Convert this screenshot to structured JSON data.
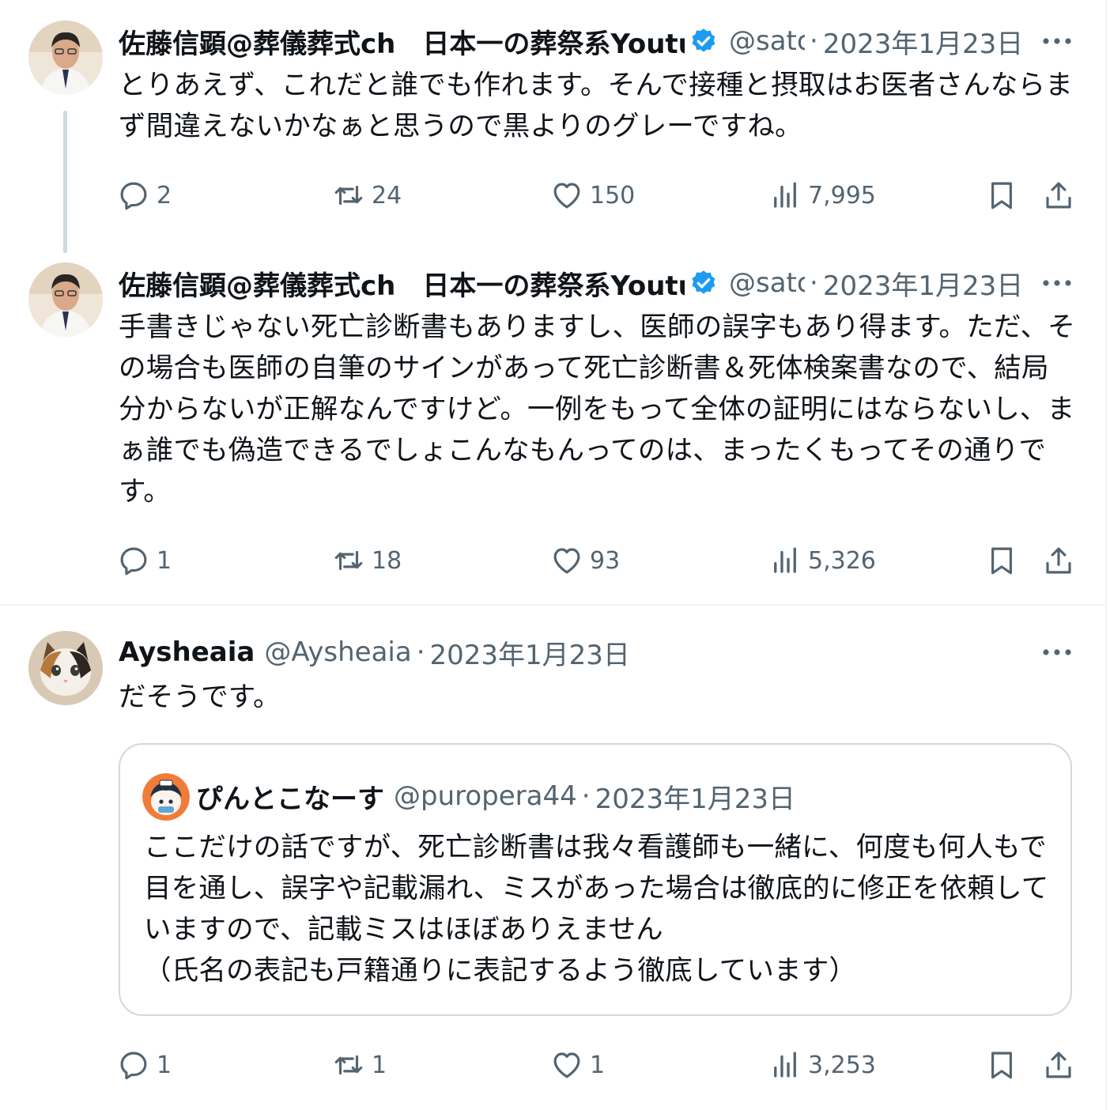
{
  "tweets": [
    {
      "author_name": "佐藤信顕@葬儀葬式ch　日本一の葬祭系Youtuber",
      "handle": "@satc",
      "date": "2023年1月23日",
      "text": "とりあえず、これだと誰でも作れます。そんで接種と摂取はお医者さんならまず間違えないかなぁと思うので黒よりのグレーですね。",
      "replies": "2",
      "retweets": "24",
      "likes": "150",
      "views": "7,995"
    },
    {
      "author_name": "佐藤信顕@葬儀葬式ch　日本一の葬祭系Youtuber",
      "handle": "@satc",
      "date": "2023年1月23日",
      "text": "手書きじゃない死亡診断書もありますし、医師の誤字もあり得ます。ただ、その場合も医師の自筆のサインがあって死亡診断書＆死体検案書なので、結局分からないが正解なんですけど。一例をもって全体の証明にはならないし、まぁ誰でも偽造できるでしょこんなもんってのは、まったくもってその通りです。",
      "replies": "1",
      "retweets": "18",
      "likes": "93",
      "views": "5,326"
    },
    {
      "author_name": "Aysheaia",
      "handle": "@Aysheaia",
      "date": "2023年1月23日",
      "text": "だそうです。",
      "replies": "1",
      "retweets": "1",
      "likes": "1",
      "views": "3,253"
    }
  ],
  "quote": {
    "author_name": "ぴんとこなーす",
    "handle": "@puropera44",
    "date": "2023年1月23日",
    "text": "ここだけの話ですが、死亡診断書は我々看護師も一緒に、何度も何人もで目を通し、誤字や記載漏れ、ミスがあった場合は徹底的に修正を依頼していますので、記載ミスはほぼありえません\n（氏名の表記も戸籍通りに表記するよう徹底しています）"
  },
  "separator": "·",
  "icons": {
    "verified": "verified-badge-icon",
    "more": "more-options-icon",
    "reply": "reply-icon",
    "retweet": "retweet-icon",
    "like": "heart-icon",
    "views": "views-icon",
    "bookmark": "bookmark-icon",
    "share": "share-icon"
  },
  "colors": {
    "text": "#0f1419",
    "secondary": "#536471",
    "verified": "#1d9bf0",
    "border": "#cfd9de"
  }
}
